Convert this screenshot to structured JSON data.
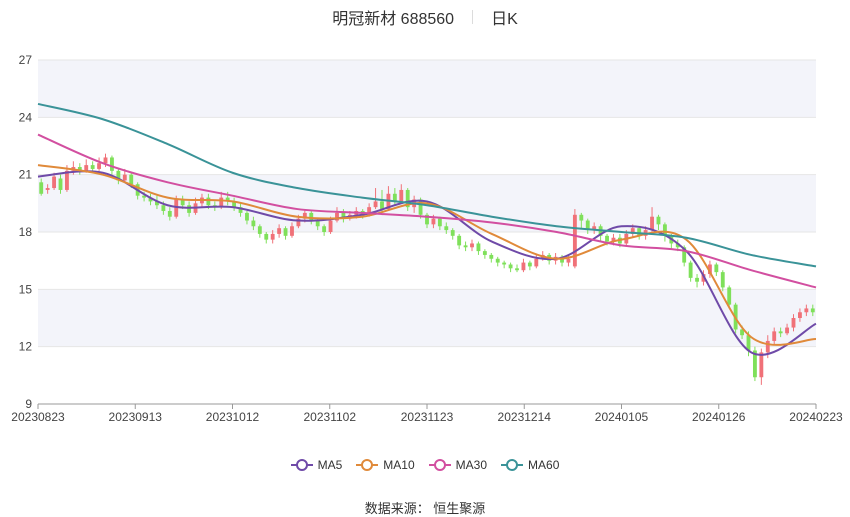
{
  "header": {
    "title": "明冠新材 688560",
    "period": "日K"
  },
  "source_text": "数据来源： 恒生聚源",
  "colors": {
    "up": "#f07178",
    "down": "#7fe05a",
    "ma5": "#6f4aa8",
    "ma10": "#e08a3a",
    "ma30": "#d24fa0",
    "ma60": "#3a9398",
    "band": "#f3f4fa",
    "grid": "#e6e6e6"
  },
  "chart_data": {
    "type": "candlestick",
    "title": "明冠新材 688560",
    "subtitle": "日K",
    "ylim": [
      9,
      27
    ],
    "yticks": [
      9,
      12,
      15,
      18,
      21,
      24,
      27
    ],
    "xlim": [
      0,
      120
    ],
    "x_tick_labels": [
      {
        "label": "20230823",
        "x": 0
      },
      {
        "label": "20230913",
        "x": 15
      },
      {
        "label": "20231012",
        "x": 30
      },
      {
        "label": "20231102",
        "x": 45
      },
      {
        "label": "20231123",
        "x": 60
      },
      {
        "label": "20231214",
        "x": 75
      },
      {
        "label": "20240105",
        "x": 90
      },
      {
        "label": "20240126",
        "x": 105
      },
      {
        "label": "20240223",
        "x": 120
      }
    ],
    "candles": [
      [
        20.6,
        20.0,
        20.8,
        19.9
      ],
      [
        20.2,
        20.3,
        20.5,
        20.0
      ],
      [
        20.3,
        20.9,
        21.1,
        20.2
      ],
      [
        20.8,
        20.2,
        21.0,
        20.0
      ],
      [
        20.2,
        21.2,
        21.5,
        20.1
      ],
      [
        21.2,
        21.4,
        21.7,
        21.0
      ],
      [
        21.4,
        21.2,
        21.6,
        21.0
      ],
      [
        21.2,
        21.5,
        21.8,
        21.1
      ],
      [
        21.5,
        21.3,
        21.7,
        21.1
      ],
      [
        21.3,
        21.6,
        21.9,
        21.2
      ],
      [
        21.6,
        21.9,
        22.1,
        21.4
      ],
      [
        21.9,
        21.2,
        22.0,
        21.0
      ],
      [
        21.2,
        20.7,
        21.3,
        20.5
      ],
      [
        20.7,
        21.0,
        21.3,
        20.6
      ],
      [
        21.0,
        20.5,
        21.1,
        20.3
      ],
      [
        20.5,
        19.9,
        20.6,
        19.7
      ],
      [
        19.9,
        19.8,
        20.1,
        19.6
      ],
      [
        19.8,
        19.6,
        20.0,
        19.4
      ],
      [
        19.6,
        19.4,
        19.9,
        19.2
      ],
      [
        19.4,
        19.1,
        19.6,
        18.9
      ],
      [
        19.1,
        18.8,
        19.3,
        18.6
      ],
      [
        18.8,
        19.7,
        19.9,
        18.7
      ],
      [
        19.7,
        19.4,
        19.9,
        19.2
      ],
      [
        19.4,
        19.0,
        19.6,
        18.8
      ],
      [
        19.0,
        19.5,
        19.8,
        18.9
      ],
      [
        19.5,
        19.8,
        20.0,
        19.3
      ],
      [
        19.8,
        19.4,
        20.0,
        19.2
      ],
      [
        19.4,
        19.3,
        19.6,
        19.1
      ],
      [
        19.3,
        19.8,
        20.1,
        19.2
      ],
      [
        19.8,
        19.6,
        20.1,
        19.4
      ],
      [
        19.6,
        19.3,
        19.8,
        19.1
      ],
      [
        19.3,
        19.0,
        19.5,
        18.8
      ],
      [
        19.0,
        18.6,
        19.1,
        18.4
      ],
      [
        18.6,
        18.3,
        18.8,
        18.1
      ],
      [
        18.3,
        17.9,
        18.4,
        17.7
      ],
      [
        17.9,
        17.6,
        18.0,
        17.4
      ],
      [
        17.6,
        17.9,
        18.1,
        17.4
      ],
      [
        17.9,
        18.2,
        18.4,
        17.7
      ],
      [
        18.2,
        17.8,
        18.3,
        17.6
      ],
      [
        17.8,
        18.3,
        18.5,
        17.7
      ],
      [
        18.3,
        18.7,
        18.9,
        18.2
      ],
      [
        18.7,
        19.0,
        19.2,
        18.5
      ],
      [
        19.0,
        18.6,
        19.1,
        18.4
      ],
      [
        18.6,
        18.3,
        18.7,
        18.1
      ],
      [
        18.3,
        18.0,
        18.4,
        17.8
      ],
      [
        18.0,
        18.6,
        18.8,
        17.9
      ],
      [
        18.6,
        19.0,
        19.3,
        18.5
      ],
      [
        19.0,
        18.7,
        19.2,
        18.5
      ],
      [
        18.7,
        18.9,
        19.1,
        18.6
      ],
      [
        18.9,
        19.1,
        19.3,
        18.7
      ],
      [
        19.1,
        18.9,
        19.2,
        18.7
      ],
      [
        18.9,
        19.3,
        19.5,
        18.8
      ],
      [
        19.3,
        19.6,
        20.3,
        19.2
      ],
      [
        19.6,
        19.2,
        20.2,
        19.0
      ],
      [
        19.2,
        20.0,
        20.4,
        19.1
      ],
      [
        20.0,
        19.6,
        20.3,
        19.4
      ],
      [
        19.6,
        20.2,
        20.5,
        19.5
      ],
      [
        20.2,
        19.3,
        20.3,
        19.1
      ],
      [
        19.3,
        19.7,
        19.9,
        19.0
      ],
      [
        19.7,
        18.9,
        19.8,
        18.7
      ],
      [
        18.9,
        18.4,
        19.0,
        18.2
      ],
      [
        18.4,
        18.7,
        18.9,
        18.2
      ],
      [
        18.7,
        18.3,
        18.8,
        18.1
      ],
      [
        18.3,
        18.1,
        18.5,
        17.9
      ],
      [
        18.1,
        17.8,
        18.2,
        17.6
      ],
      [
        17.8,
        17.3,
        17.9,
        17.1
      ],
      [
        17.3,
        17.2,
        17.5,
        17.0
      ],
      [
        17.2,
        17.4,
        17.6,
        17.0
      ],
      [
        17.4,
        17.0,
        17.5,
        16.8
      ],
      [
        17.0,
        16.8,
        17.1,
        16.6
      ],
      [
        16.8,
        16.6,
        16.9,
        16.4
      ],
      [
        16.6,
        16.4,
        16.7,
        16.2
      ],
      [
        16.4,
        16.3,
        16.5,
        16.1
      ],
      [
        16.3,
        16.1,
        16.4,
        15.9
      ],
      [
        16.1,
        16.0,
        16.3,
        15.9
      ],
      [
        16.0,
        16.4,
        16.6,
        15.9
      ],
      [
        16.4,
        16.2,
        16.5,
        16.0
      ],
      [
        16.2,
        16.6,
        16.8,
        16.1
      ],
      [
        16.6,
        16.8,
        17.0,
        16.5
      ],
      [
        16.8,
        16.5,
        16.9,
        16.3
      ],
      [
        16.5,
        16.7,
        16.9,
        16.3
      ],
      [
        16.7,
        16.4,
        16.8,
        16.2
      ],
      [
        16.4,
        16.6,
        16.8,
        16.2
      ],
      [
        16.2,
        18.9,
        19.2,
        16.1
      ],
      [
        18.9,
        18.6,
        19.0,
        18.2
      ],
      [
        18.6,
        18.1,
        18.7,
        17.9
      ],
      [
        18.1,
        18.3,
        18.5,
        17.9
      ],
      [
        18.3,
        17.8,
        18.4,
        17.5
      ],
      [
        17.8,
        17.5,
        17.9,
        17.3
      ],
      [
        17.5,
        17.7,
        17.9,
        17.3
      ],
      [
        17.7,
        17.4,
        17.9,
        17.2
      ],
      [
        17.4,
        17.9,
        18.1,
        17.3
      ],
      [
        17.9,
        18.2,
        18.4,
        17.7
      ],
      [
        18.2,
        17.8,
        18.3,
        17.6
      ],
      [
        17.8,
        18.1,
        18.3,
        17.6
      ],
      [
        18.1,
        18.8,
        19.3,
        17.9
      ],
      [
        18.8,
        18.4,
        18.9,
        18.1
      ],
      [
        18.4,
        17.8,
        18.5,
        17.5
      ],
      [
        17.8,
        17.4,
        17.9,
        17.1
      ],
      [
        17.4,
        17.2,
        17.6,
        17.0
      ],
      [
        17.2,
        16.4,
        17.3,
        16.2
      ],
      [
        16.4,
        15.6,
        16.5,
        15.4
      ],
      [
        15.6,
        15.4,
        15.8,
        15.1
      ],
      [
        15.4,
        15.8,
        16.0,
        15.2
      ],
      [
        15.8,
        16.3,
        16.5,
        15.6
      ],
      [
        16.3,
        15.9,
        16.4,
        15.7
      ],
      [
        15.9,
        15.1,
        16.0,
        14.9
      ],
      [
        15.1,
        14.2,
        15.2,
        14.0
      ],
      [
        14.2,
        12.9,
        14.3,
        12.7
      ],
      [
        12.9,
        12.6,
        13.1,
        12.4
      ],
      [
        12.6,
        11.8,
        12.8,
        11.5
      ],
      [
        11.8,
        10.4,
        12.0,
        10.2
      ],
      [
        10.4,
        11.7,
        11.9,
        10.0
      ],
      [
        11.7,
        12.3,
        12.6,
        11.4
      ],
      [
        12.3,
        12.8,
        13.0,
        12.1
      ],
      [
        12.8,
        12.7,
        13.0,
        12.5
      ],
      [
        12.7,
        13.0,
        13.2,
        12.6
      ],
      [
        13.0,
        13.5,
        13.7,
        12.8
      ],
      [
        13.5,
        13.8,
        14.0,
        13.3
      ],
      [
        13.8,
        14.0,
        14.2,
        13.6
      ],
      [
        14.0,
        13.8,
        14.2,
        13.6
      ]
    ],
    "ma_points_x": [
      0,
      10,
      20,
      30,
      40,
      50,
      60,
      70,
      80,
      90,
      100,
      110,
      120
    ],
    "series": [
      {
        "name": "MA5",
        "values": [
          20.9,
          21.1,
          19.4,
          19.3,
          18.6,
          18.9,
          19.6,
          17.5,
          16.6,
          18.3,
          17.0,
          11.7,
          13.2
        ]
      },
      {
        "name": "MA10",
        "values": [
          21.5,
          21.0,
          19.8,
          19.6,
          18.8,
          18.8,
          19.5,
          17.9,
          16.6,
          17.6,
          17.6,
          12.5,
          12.4
        ]
      },
      {
        "name": "MA30",
        "values": [
          23.1,
          21.6,
          20.6,
          19.9,
          19.2,
          19.0,
          18.8,
          18.5,
          18.0,
          17.3,
          17.0,
          16.0,
          15.1
        ]
      },
      {
        "name": "MA60",
        "values": [
          24.7,
          23.9,
          22.6,
          21.1,
          20.3,
          19.8,
          19.4,
          18.8,
          18.3,
          18.0,
          17.7,
          16.8,
          16.2
        ]
      }
    ]
  }
}
